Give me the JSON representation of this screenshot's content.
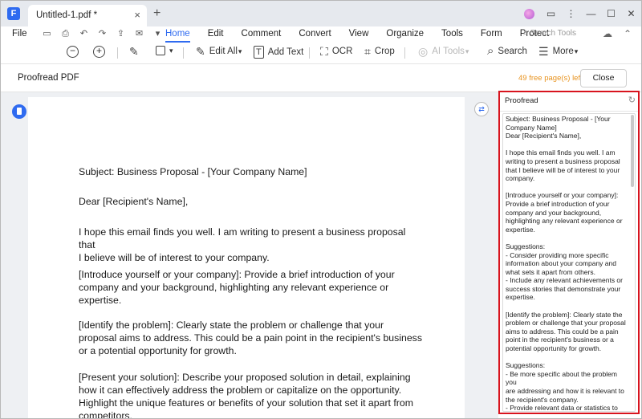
{
  "app": {
    "logo_glyph": "F",
    "tab_title": "Untitled-1.pdf *",
    "tab_close_glyph": "×",
    "tab_add_glyph": "+",
    "brand_color": "#2f6bf0"
  },
  "window_controls": {
    "avatar": "avatar-icon",
    "feedback_glyph": "▭",
    "more_glyph": "⋮",
    "minimize_glyph": "—",
    "maximize_glyph": "☐",
    "close_glyph": "✕"
  },
  "menubar": {
    "file": "File",
    "quick_access_icons": [
      "save-icon",
      "print-icon",
      "undo-icon",
      "redo-icon",
      "share-icon",
      "mail-icon",
      "dropdown-icon"
    ],
    "quick_access_glyphs": [
      "▭",
      "⎙",
      "↶",
      "↷",
      "⇪",
      "✉",
      "▾"
    ],
    "items": [
      "Home",
      "Edit",
      "Comment",
      "Convert",
      "View",
      "Organize",
      "Tools",
      "Form",
      "Protect"
    ],
    "active_item": "Home",
    "search_tools": "Search Tools",
    "search_tools_glyph": "⌕",
    "cloud_glyph": "☁",
    "collapse_glyph": "⌃"
  },
  "toolbar": {
    "zoom_out_glyph": "−",
    "zoom_in_glyph": "+",
    "highlight_glyph": "✎",
    "shape_glyph": "▾",
    "edit_all": "Edit All",
    "edit_all_glyph": "✎",
    "add_text": "Add Text",
    "add_text_glyph": "T",
    "ocr": "OCR",
    "ocr_glyph": "⛶",
    "crop": "Crop",
    "crop_glyph": "⌗",
    "ai_tools": "AI Tools",
    "ai_tools_glyph": "◎",
    "search": "Search",
    "search_glyph": "⌕",
    "more": "More",
    "more_glyph": "☰"
  },
  "proofread_bar": {
    "title": "Proofread PDF",
    "free_pages": "49 free page(s) left",
    "close": "Close"
  },
  "workspace": {
    "translate_glyph": "⇄"
  },
  "document": {
    "paragraphs": [
      "Subject: Business Proposal - [Your Company Name]",
      "Dear [Recipient's Name],",
      "I hope this email finds you well. I am writing to present a business proposal that\nI believe will be of interest to your company.",
      "[Introduce yourself or your company]: Provide a brief introduction of your\ncompany and your background, highlighting any relevant experience or\nexpertise.",
      "[Identify the problem]: Clearly state the problem or challenge that your\nproposal aims to address. This could be a pain point in the recipient's business\nor a potential opportunity for growth.",
      "[Present your solution]: Describe your proposed solution in detail, explaining\nhow it can effectively address the problem or capitalize on the opportunity.\nHighlight the unique features or benefits of your solution that set it apart from\ncompetitors."
    ]
  },
  "proofread_panel": {
    "title": "Proofread",
    "refresh_glyph": "↻",
    "highlight_color": "#d8141e",
    "text": "Subject: Business Proposal - [Your\nCompany Name]\nDear [Recipient's Name],\n\nI hope this email finds you well. I am\nwriting to present a business proposal\nthat I believe will be of interest to your\ncompany.\n\n[Introduce yourself or your company]:\nProvide a brief introduction of your\ncompany and your background,\nhighlighting any relevant experience or\nexpertise.\n\nSuggestions:\n- Consider providing more specific\ninformation about your company and\nwhat sets it apart from others.\n- Include any relevant achievements or\nsuccess stories that demonstrate your\nexpertise.\n\n[Identify the problem]: Clearly state the\nproblem or challenge that your proposal\naims to address. This could be a pain\npoint in the recipient's business or a\npotential opportunity for growth.\n\nSuggestions:\n- Be more specific about the problem you\nare addressing and how it is relevant to\nthe recipient's company.\n- Provide relevant data or statistics to\nsupport your claim about the problem."
  }
}
